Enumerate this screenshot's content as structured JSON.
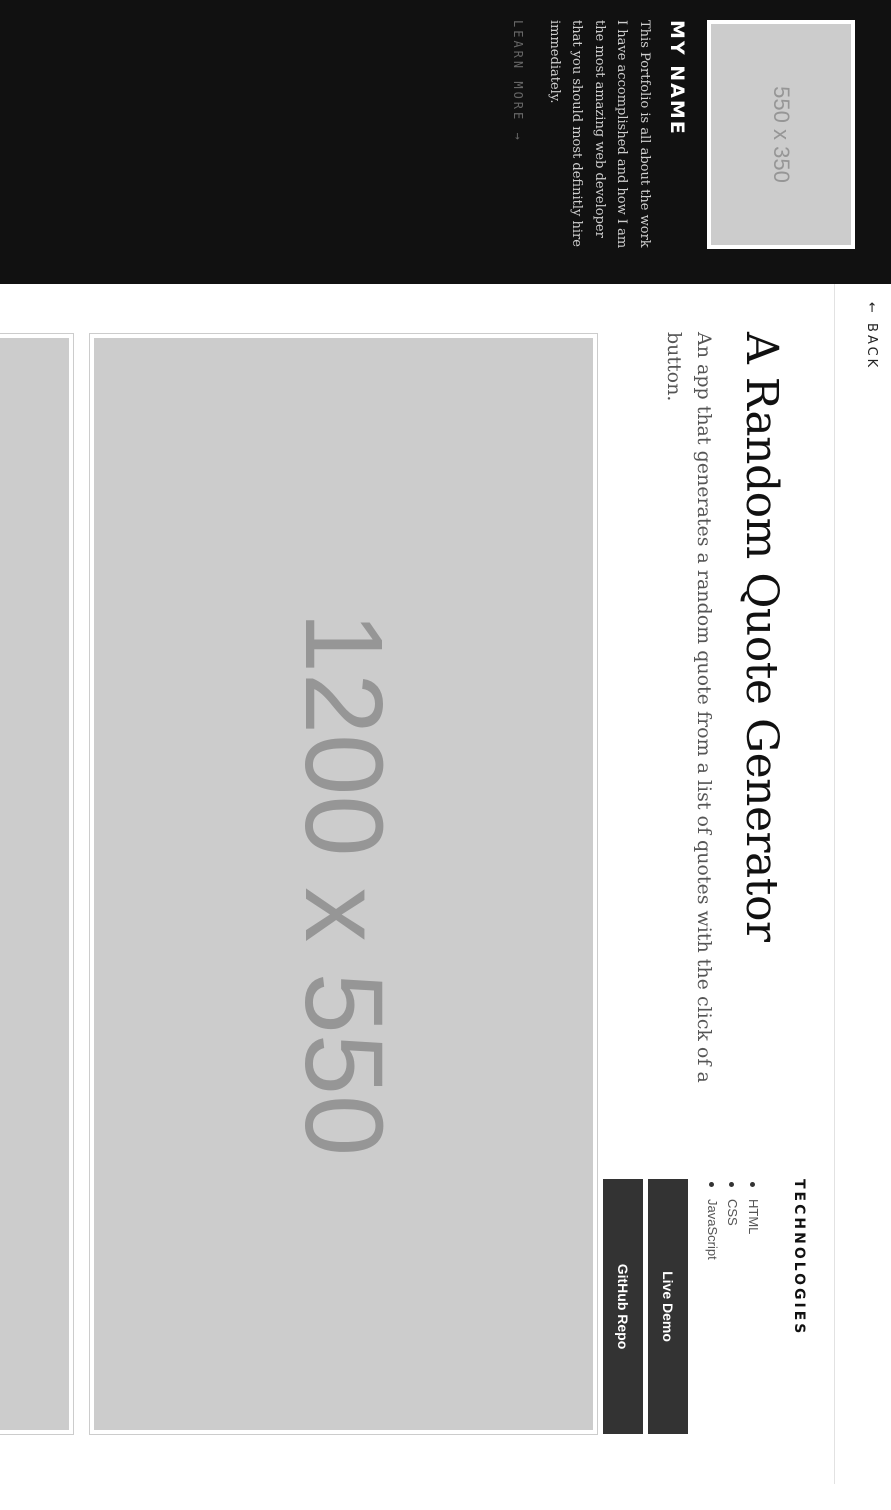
{
  "sidebar": {
    "thumbnail_label": "550 x 350",
    "name": "MY NAME",
    "bio": "This Portfolio is all about the work I have accomplished and how I am the most amazing web developer that you should most definitly hire immediately.",
    "learn_more": "LEARN MORE →"
  },
  "nav": {
    "back_label": "← BACK"
  },
  "project": {
    "title": "A Random Quote Generator",
    "description": "An app that generates a random quote from a list of quotes with the click of a button.",
    "technologies_heading": "TECHNOLOGIES",
    "technologies": [
      "HTML",
      "CSS",
      "JavaScript"
    ],
    "live_demo_label": "Live Demo",
    "github_label": "GitHub Repo",
    "screenshot_label": "1200 x 550"
  },
  "colors": {
    "header_background": "#111111",
    "button_background": "#333333",
    "placeholder": "#cccccc",
    "placeholder_text": "#969696"
  }
}
